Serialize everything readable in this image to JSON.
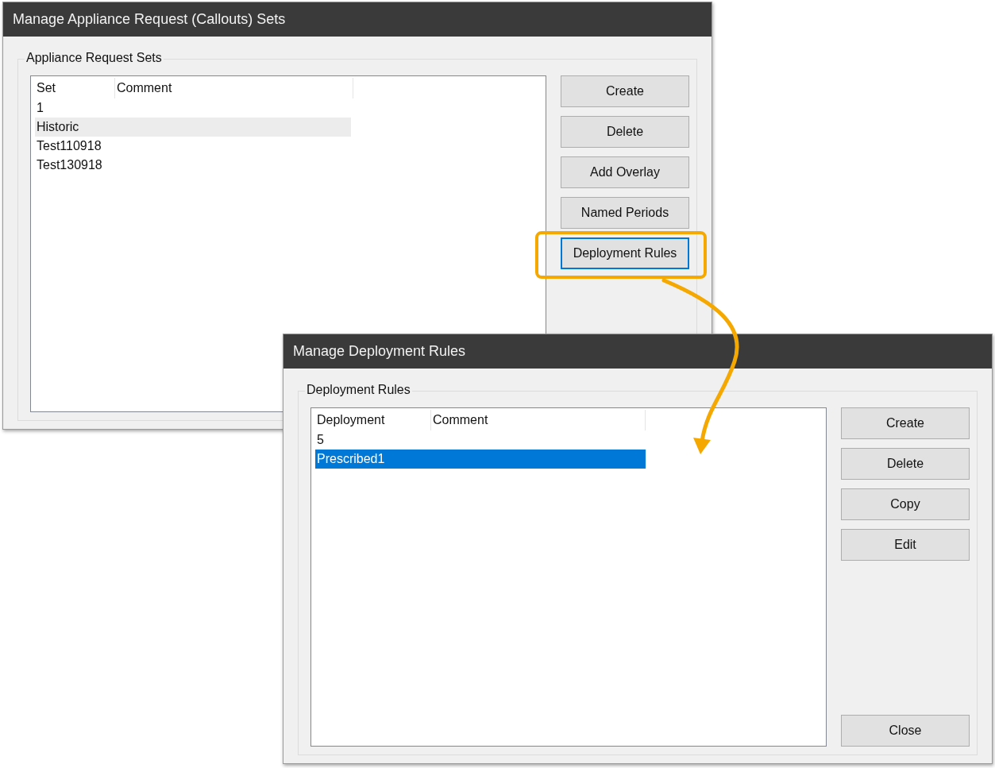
{
  "windows": [
    {
      "title": "Manage Appliance Request (Callouts) Sets",
      "group_label": "Appliance Request Sets",
      "columns": [
        "Set",
        "Comment"
      ],
      "rows": [
        {
          "cells": [
            "1"
          ],
          "selected": false,
          "hovered": false
        },
        {
          "cells": [
            "Historic"
          ],
          "selected": false,
          "hovered": true
        },
        {
          "cells": [
            "Test110918"
          ],
          "selected": false,
          "hovered": false
        },
        {
          "cells": [
            "Test130918"
          ],
          "selected": false,
          "hovered": false
        }
      ],
      "buttons": [
        {
          "label": "Create",
          "focused": false,
          "highlighted": false
        },
        {
          "label": "Delete",
          "focused": false,
          "highlighted": false
        },
        {
          "label": "Add Overlay",
          "focused": false,
          "highlighted": false
        },
        {
          "label": "Named Periods",
          "focused": false,
          "highlighted": false
        },
        {
          "label": "Deployment Rules",
          "focused": true,
          "highlighted": true
        }
      ]
    },
    {
      "title": "Manage Deployment Rules",
      "group_label": "Deployment Rules",
      "columns": [
        "Deployment",
        "Comment"
      ],
      "rows": [
        {
          "cells": [
            "5"
          ],
          "selected": false,
          "hovered": false
        },
        {
          "cells": [
            "Prescribed1"
          ],
          "selected": true,
          "hovered": false
        }
      ],
      "buttons": [
        {
          "label": "Create",
          "focused": false,
          "highlighted": false
        },
        {
          "label": "Delete",
          "focused": false,
          "highlighted": false
        },
        {
          "label": "Copy",
          "focused": false,
          "highlighted": false
        },
        {
          "label": "Edit",
          "focused": false,
          "highlighted": false
        }
      ],
      "bottom_buttons": [
        {
          "label": "Close",
          "focused": false,
          "highlighted": false
        }
      ]
    }
  ]
}
